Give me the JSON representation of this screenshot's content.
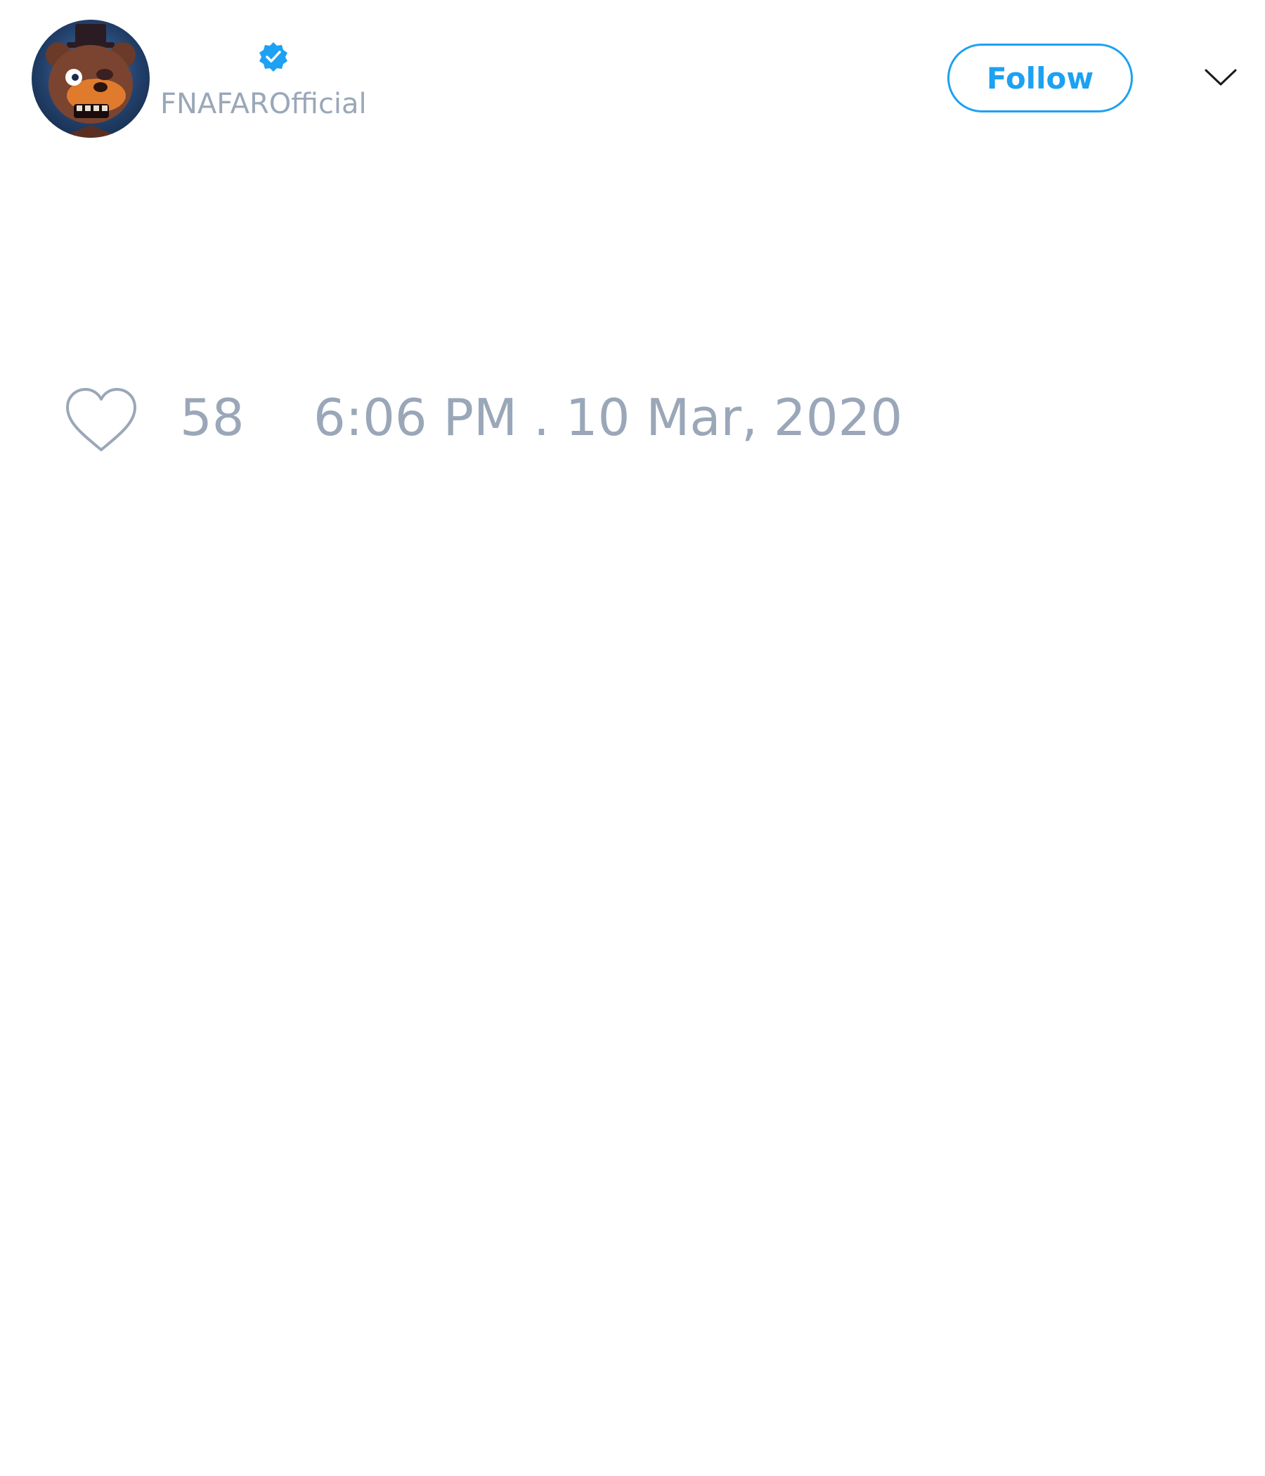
{
  "tweet": {
    "author": {
      "handle": "FNAFAROfficial",
      "verified": true,
      "avatar_icon": "animatronic-bear-avatar"
    },
    "follow_label": "Follow",
    "menu_icon": "chevron-down-icon",
    "likes": "58",
    "timestamp": "6:06 PM . 10 Mar, 2020"
  },
  "colors": {
    "accent": "#1da1f2",
    "muted_text": "#9aa7b8",
    "background": "#ffffff"
  }
}
